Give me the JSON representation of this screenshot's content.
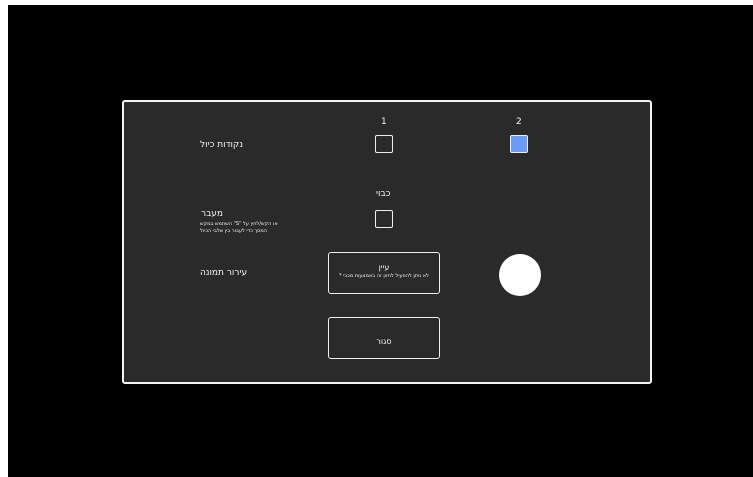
{
  "columns": [
    "1",
    "2"
  ],
  "calibration": {
    "label": "נקודות כיול",
    "point1_checked": false,
    "point2_checked": true
  },
  "transition": {
    "column_header": "כבוי",
    "label": "מעבר",
    "subtext_line1": "או הקש/לחץ על \"S\" השתמש במקש",
    "subtext_line2": "המסך כדי לעבור בין שלבי הכיול",
    "checked": false
  },
  "image_blur": {
    "label": "עירור תמונה",
    "button_title": "עיין",
    "button_subtitle": "לא ניתן להפעיל לחזון זה באמצעות מכבי *"
  },
  "close_button": {
    "label": "סגור"
  },
  "colors": {
    "background": "#000000",
    "panel": "#2a2a2a",
    "accent": "#6b9bf6",
    "text": "#f5f5f5"
  }
}
